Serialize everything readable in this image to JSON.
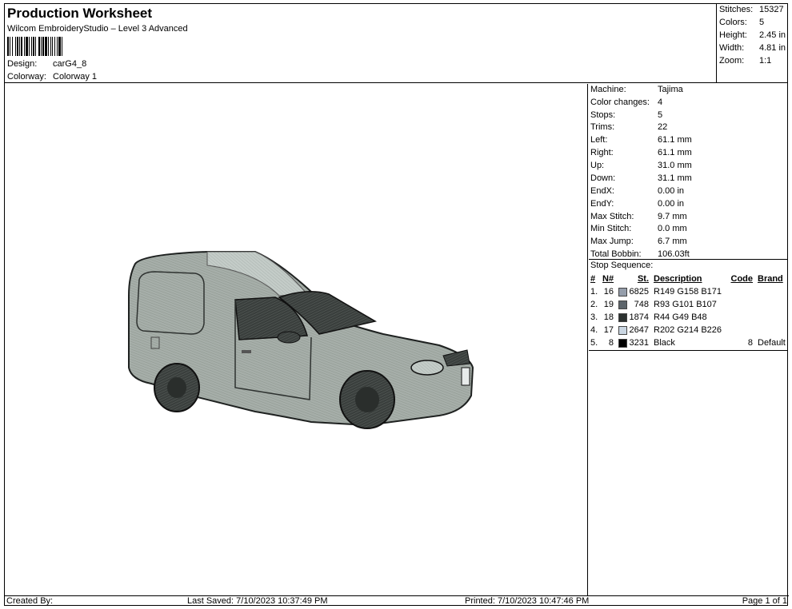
{
  "header": {
    "title": "Production Worksheet",
    "subtitle": "Wilcom EmbroideryStudio – Level 3 Advanced",
    "design_label": "Design:",
    "design_value": "carG4_8",
    "colorway_label": "Colorway:",
    "colorway_value": "Colorway 1"
  },
  "summary": {
    "stitches_label": "Stitches:",
    "stitches_value": "15327",
    "colors_label": "Colors:",
    "colors_value": "5",
    "height_label": "Height:",
    "height_value": "2.45 in",
    "width_label": "Width:",
    "width_value": "4.81 in",
    "zoom_label": "Zoom:",
    "zoom_value": "1:1"
  },
  "info": {
    "machine_label": "Machine:",
    "machine_value": "Tajima",
    "color_changes_label": "Color changes:",
    "color_changes_value": "4",
    "stops_label": "Stops:",
    "stops_value": "5",
    "trims_label": "Trims:",
    "trims_value": "22",
    "left_label": "Left:",
    "left_value": "61.1 mm",
    "right_label": "Right:",
    "right_value": "61.1 mm",
    "up_label": "Up:",
    "up_value": "31.0 mm",
    "down_label": "Down:",
    "down_value": "31.1 mm",
    "endx_label": "EndX:",
    "endx_value": "0.00 in",
    "endy_label": "EndY:",
    "endy_value": "0.00 in",
    "max_stitch_label": "Max Stitch:",
    "max_stitch_value": "9.7 mm",
    "min_stitch_label": "Min Stitch:",
    "min_stitch_value": "0.0 mm",
    "max_jump_label": "Max Jump:",
    "max_jump_value": "6.7 mm",
    "total_bobbin_label": "Total Bobbin:",
    "total_bobbin_value": "106.03ft"
  },
  "stop_sequence": {
    "title": "Stop Sequence:",
    "headers": {
      "num": "#",
      "n": "N#",
      "st": "St.",
      "description": "Description",
      "code": "Code",
      "brand": "Brand"
    },
    "rows": [
      {
        "num": "1.",
        "n": "16",
        "color": "#959eab",
        "st": "6825",
        "description": "R149 G158 B171",
        "code": "",
        "brand": ""
      },
      {
        "num": "2.",
        "n": "19",
        "color": "#5d656b",
        "st": "748",
        "description": "R93 G101 B107",
        "code": "",
        "brand": ""
      },
      {
        "num": "3.",
        "n": "18",
        "color": "#2c3130",
        "st": "1874",
        "description": "R44 G49 B48",
        "code": "",
        "brand": ""
      },
      {
        "num": "4.",
        "n": "17",
        "color": "#cad6e2",
        "st": "2647",
        "description": "R202 G214 B226",
        "code": "",
        "brand": ""
      },
      {
        "num": "5.",
        "n": "8",
        "color": "#000000",
        "st": "3231",
        "description": "Black",
        "code": "8",
        "brand": "Default"
      }
    ]
  },
  "footer": {
    "created_by": "Created By:",
    "last_saved": "Last Saved: 7/10/2023 10:37:49 PM",
    "printed": "Printed: 7/10/2023 10:47:46 PM",
    "page": "Page 1 of 1"
  }
}
